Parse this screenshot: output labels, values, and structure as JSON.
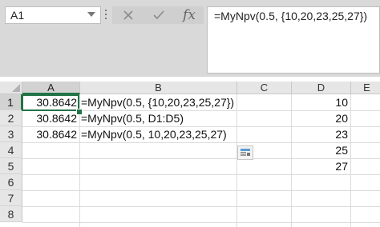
{
  "formula_bar": {
    "name_box": "A1",
    "cancel_icon": "cancel-x-icon",
    "enter_icon": "checkmark-icon",
    "fx_label": "fx",
    "formula": "=MyNpv(0.5, {10,20,23,25,27})"
  },
  "columns": [
    "A",
    "B",
    "C",
    "D",
    "E"
  ],
  "rows": [
    "1",
    "2",
    "3",
    "4",
    "5",
    "6",
    "7",
    "8"
  ],
  "cells": {
    "A1": "30.8642",
    "B1": "=MyNpv(0.5, {10,20,23,25,27})",
    "A2": "30.8642",
    "B2": "=MyNpv(0.5, D1:D5)",
    "A3": "30.8642",
    "B3": "=MyNpv(0.5, 10,20,23,25,27)",
    "D1": "10",
    "D2": "20",
    "D3": "23",
    "D4": "25",
    "D5": "27"
  },
  "colors": {
    "selection": "#217346",
    "header_bg": "#e6e6e6",
    "toolbar_bg": "#d9d9d9"
  }
}
